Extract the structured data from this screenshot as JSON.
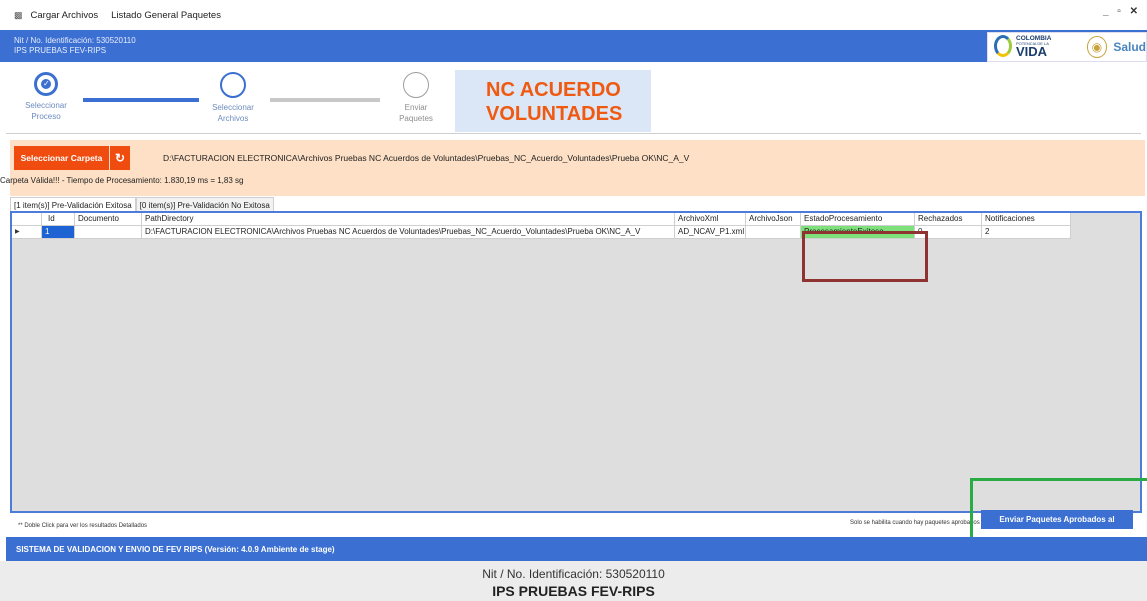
{
  "menubar": {
    "icon": "app-icon",
    "items": [
      "Cargar Archivos",
      "Listado General Paquetes"
    ],
    "controls": "_ θ ✕"
  },
  "header": {
    "nit": "Nit / No. Identificación: 530520110",
    "ips": "IPS PRUEBAS FEV-RIPS"
  },
  "logo": {
    "line1": "COLOMBIA",
    "line2": "POTENCIA DE LA",
    "line3": "VIDA",
    "salud": "Salud"
  },
  "steps": [
    {
      "label": "Seleccionar Proceso",
      "state": "done"
    },
    {
      "label": "Seleccionar Archivos",
      "state": "pending"
    },
    {
      "label": "Enviar Paquetes",
      "state": "pending"
    }
  ],
  "process_title": "NC ACUERDO VOLUNTADES",
  "toolbar": {
    "select_folder_label": "Seleccionar Carpeta",
    "refresh_icon": "refresh-icon",
    "folder_path": "D:\\FACTURACION ELECTRONICA\\Archivos Pruebas NC  Acuerdos de Voluntades\\Pruebas_NC_Acuerdo_Voluntades\\Prueba OK\\NC_A_V",
    "status": "Carpeta Válida!!! - Tiempo de Procesamiento: 1.830,19 ms = 1,83 sg"
  },
  "tabs": [
    {
      "label": "[1 item(s)] Pre-Validación Exitosa",
      "active": true
    },
    {
      "label": "[0 item(s)] Pre-Validación No Exitosa",
      "active": false
    }
  ],
  "grid": {
    "columns": [
      "",
      "Id",
      "Documento",
      "PathDirectory",
      "ArchivoXml",
      "ArchivoJson",
      "EstadoProcesamiento",
      "Rechazados",
      "Notificaciones"
    ],
    "rows": [
      [
        "",
        "1",
        "",
        "D:\\FACTURACION ELECTRONICA\\Archivos Pruebas NC  Acuerdos de Voluntades\\Pruebas_NC_Acuerdo_Voluntades\\Prueba OK\\NC_A_V",
        "AD_NCAV_P1.xml",
        "",
        "ProcesamientoExitoso",
        "0",
        "2"
      ]
    ]
  },
  "footer": {
    "hint": "** Doble Click para ver los resultados Detallados",
    "note": "Solo se habilita cuando hay paquetes aprobados",
    "send_label": "Enviar Paquetes Aprobados al"
  },
  "statusbar": "SISTEMA DE VALIDACION Y ENVIO DE FEV RIPS  (Versión: 4.0.9 Ambiente de stage)",
  "bottom": {
    "nit": "Nit / No. Identificación: 530520110",
    "ips": "IPS PRUEBAS FEV-RIPS"
  },
  "colors": {
    "primary": "#3b6fd2",
    "accent": "#f14c0f",
    "title": "#ef5a10",
    "success": "#7ee07a",
    "highlight_red": "#8e3232",
    "highlight_green": "#29ac43"
  }
}
